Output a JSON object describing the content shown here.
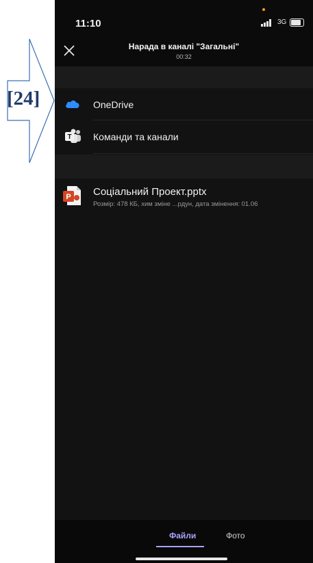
{
  "status_bar": {
    "time": "11:10",
    "network": "3G"
  },
  "header": {
    "title": "Нарада в каналі \"Загальні\"",
    "duration": "00:32"
  },
  "callout": {
    "label": "[24]"
  },
  "sources": [
    {
      "label": "OneDrive",
      "icon": "onedrive-icon"
    },
    {
      "label": "Команди та канали",
      "icon": "teams-icon"
    }
  ],
  "recent_file": {
    "name": "Соціальний Проект.pptx",
    "meta": "Розмір: 478 КБ, хим зміне ...рдун, дата змінення: 01.06",
    "icon": "powerpoint-icon"
  },
  "tabs": [
    {
      "label": "Файли",
      "selected": true
    },
    {
      "label": "Фото",
      "selected": false
    }
  ],
  "colors": {
    "accent": "#a9a3ff",
    "background": "#121212",
    "callout": "#1f3b6b"
  }
}
